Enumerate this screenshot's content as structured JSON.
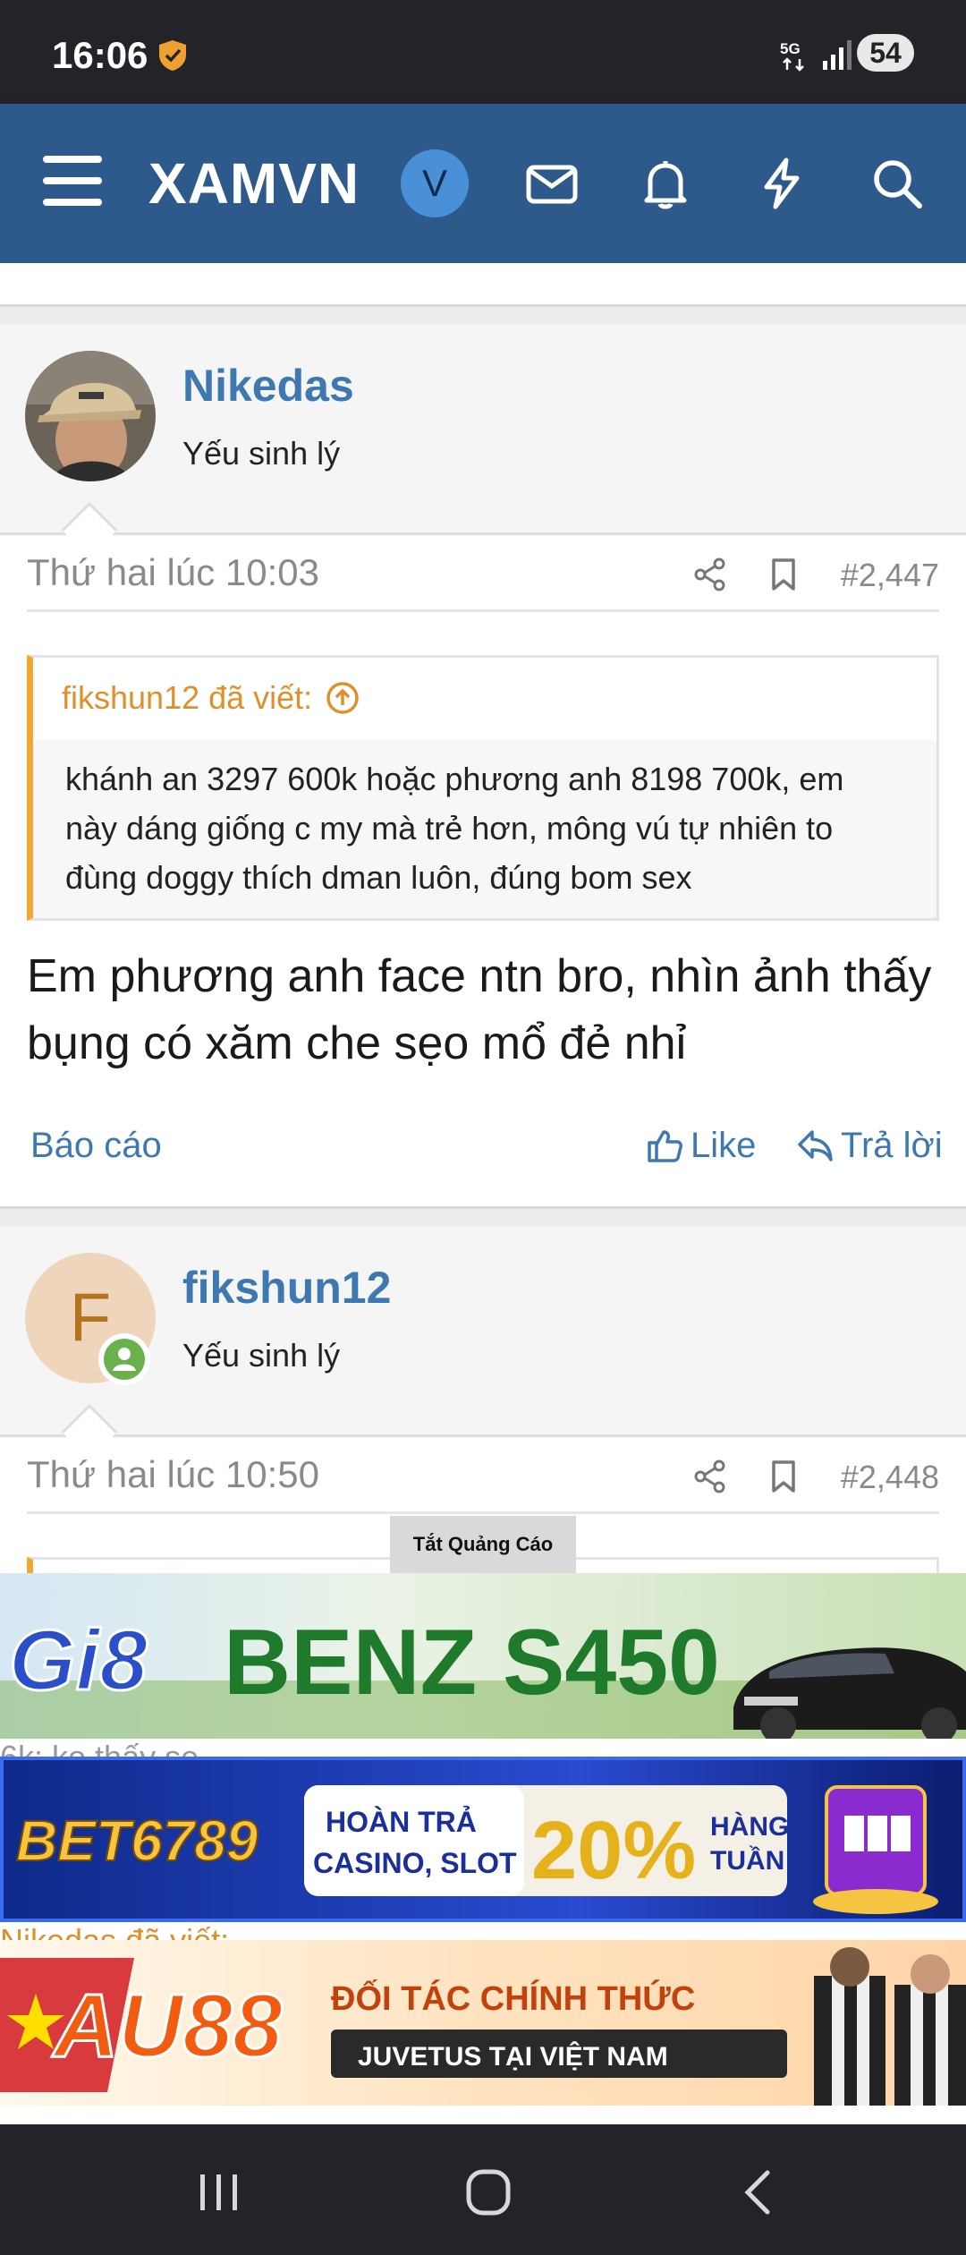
{
  "status_bar": {
    "time": "16:06",
    "battery": "54"
  },
  "app_bar": {
    "brand": "XAMVN",
    "avatar_letter": "V"
  },
  "posts": [
    {
      "username": "Nikedas",
      "user_title": "Yếu sinh lý",
      "date": "Thứ hai lúc 10:03",
      "number": "#2,447",
      "quote_author": "fikshun12 đã viết:",
      "quote_text": "khánh an 3297 600k hoặc phương anh 8198 700k, em này dáng giống c my mà trẻ hơn, mông vú tự nhiên to đùng doggy thích dman luôn, đúng bom sex",
      "text": "Em phương anh face ntn bro, nhìn ảnh thấy bụng có xăm che sẹo mổ đẻ nhỉ",
      "report": "Báo cáo",
      "like": "Like",
      "reply": "Trả lời"
    },
    {
      "username": "fikshun12",
      "avatar_letter": "F",
      "user_title": "Yếu sinh lý",
      "date": "Thứ hai lúc 10:50",
      "number": "#2,448",
      "peek_text_1": "6k: ko thấy se",
      "peek_text_2": "Nikedas đã viết:"
    }
  ],
  "ads": {
    "close_label": "Tắt Quảng Cáo",
    "ad1": {
      "brand": "Gi8",
      "headline": "BENZ S450"
    },
    "ad2": {
      "brand": "BET6789",
      "line1": "HOÀN TRẢ",
      "line2": "CASINO, SLOT",
      "percent": "20%",
      "suffix1": "HÀNG",
      "suffix2": "TUẦN"
    },
    "ad3": {
      "brand": "AU88",
      "line1": "ĐỐI TÁC CHÍNH THỨC",
      "line2": "JUVETUS TẠI VIỆT NAM"
    }
  },
  "colors": {
    "accent": "#3d78b0",
    "header": "#2d5a8a",
    "quote_border": "#f0a830"
  }
}
